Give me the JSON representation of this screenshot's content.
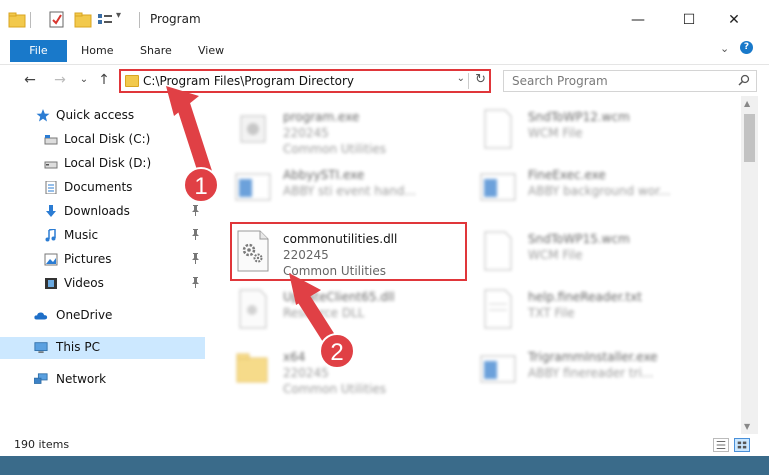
{
  "window": {
    "title": "Program",
    "minimize_glyph": "—",
    "maximize_glyph": "☐",
    "close_glyph": "✕"
  },
  "ribbon": {
    "file": "File",
    "home": "Home",
    "share": "Share",
    "view": "View",
    "expand_glyph": "⌄",
    "help_glyph": "?"
  },
  "nav": {
    "back_glyph": "←",
    "forward_glyph": "→",
    "recent_glyph": "⌄",
    "up_glyph": "↑"
  },
  "address": {
    "path": "C:\\Program Files\\Program Directory",
    "dropdown_glyph": "⌄",
    "refresh_glyph": "↻"
  },
  "search": {
    "placeholder": "Search Program"
  },
  "sidebar": {
    "items": [
      {
        "label": "Quick access",
        "icon": "star-icon"
      },
      {
        "label": "Local Disk (C:)",
        "icon": "drive-icon"
      },
      {
        "label": "Local Disk (D:)",
        "icon": "drive-icon"
      },
      {
        "label": "Documents",
        "icon": "documents-icon"
      },
      {
        "label": "Downloads",
        "icon": "download-icon"
      },
      {
        "label": "Music",
        "icon": "music-icon"
      },
      {
        "label": "Pictures",
        "icon": "pictures-icon"
      },
      {
        "label": "Videos",
        "icon": "videos-icon"
      },
      {
        "label": "OneDrive",
        "icon": "cloud-icon"
      },
      {
        "label": "This PC",
        "icon": "computer-icon"
      },
      {
        "label": "Network",
        "icon": "network-icon"
      }
    ],
    "pin_glyph": "📌"
  },
  "files": [
    {
      "name": "program.exe",
      "line2": "220245",
      "line3": "Common Utilities"
    },
    {
      "name": "SndToWP12.wcm",
      "line2": "WCM File",
      "line3": ""
    },
    {
      "name": "AbbyySTI.exe",
      "line2": "ABBY sti event hand...",
      "line3": ""
    },
    {
      "name": "FineExec.exe",
      "line2": "ABBY background wor...",
      "line3": ""
    },
    {
      "name": "commonutilities.dll",
      "line2": "220245",
      "line3": "Common Utilities"
    },
    {
      "name": "SndToWP15.wcm",
      "line2": "WCM File",
      "line3": ""
    },
    {
      "name": "UpdateClient65.dll",
      "line2": "Resource DLL",
      "line3": ""
    },
    {
      "name": "help.fineReader.txt",
      "line2": "TXT File",
      "line3": ""
    },
    {
      "name": "x64",
      "line2": "220245",
      "line3": "Common Utilities"
    },
    {
      "name": "TrigrammInstaller.exe",
      "line2": "ABBY finereader tri...",
      "line3": ""
    }
  ],
  "status": {
    "count": "190 items"
  },
  "callouts": {
    "one": "1",
    "two": "2"
  },
  "colors": {
    "accent": "#1979ca",
    "highlight": "#e0363a",
    "selected": "#cce8ff"
  }
}
